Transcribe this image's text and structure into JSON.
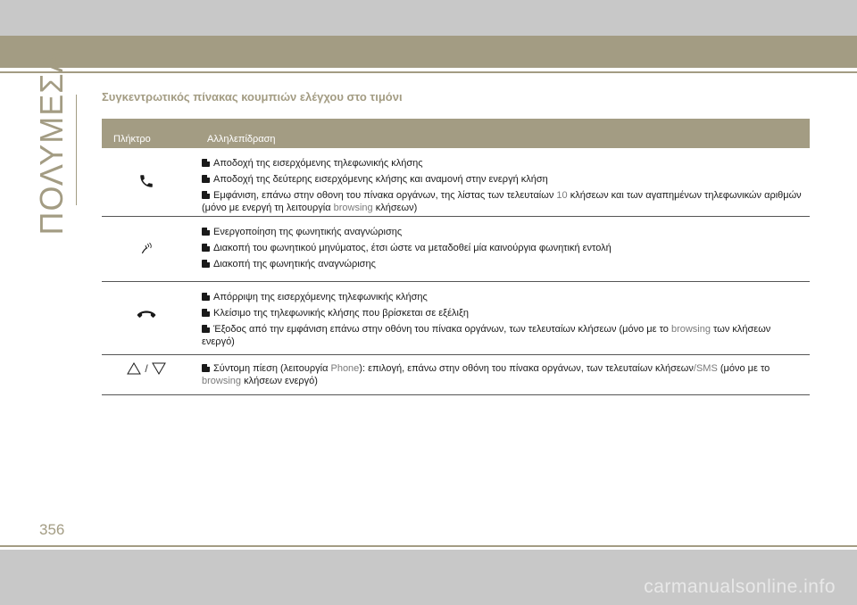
{
  "side_title": "ΠΟΛΥΜΕΣΑ",
  "section_title": "Συγκεντρωτικός πίνακας κουμπιών ελέγχου στο τιμόνι",
  "table": {
    "headers": {
      "key": "Πλήκτρο",
      "action": "Αλληλεπίδραση"
    },
    "rows": [
      {
        "icon": "phone-answer-icon",
        "items": [
          {
            "text": "Αποδοχή της εισερχόμενης τηλεφωνικής κλήσης"
          },
          {
            "text": "Αποδοχή της δεύτερης εισερχόμενης κλήσης και αναμονή στην ενεργή κλήση"
          },
          {
            "p1": "Εμφάνιση, επάνω στην οθονη του πίνακα οργάνων, της λίστας των τελευταίων ",
            "g1": "10",
            "p2": " κλήσεων και των αγαπημένων τηλεφωνικών αριθμών (μόνο με ενεργή τη λειτουργία ",
            "g2": "browsing",
            "p3": " κλήσεων)"
          }
        ]
      },
      {
        "icon": "voice-recognition-icon",
        "items": [
          {
            "text": "Ενεργοποίηση της φωνητικής αναγνώρισης"
          },
          {
            "text": "Διακοπή του φωνητικού μηνύματος, έτσι ώστε να μεταδοθεί μία καινούργια φωνητική εντολή"
          },
          {
            "text": "Διακοπή της φωνητικής αναγνώρισης"
          }
        ]
      },
      {
        "icon": "phone-hangup-icon",
        "items": [
          {
            "text": "Απόρριψη της εισερχόμενης τηλεφωνικής κλήσης"
          },
          {
            "text": "Κλείσιμο της τηλεφωνικής κλήσης που βρίσκεται σε εξέλιξη"
          },
          {
            "p1": "Έξοδος από την εμφάνιση επάνω στην οθόνη του πίνακα οργάνων, των τελευταίων κλήσεων (μόνο με το ",
            "g1": "browsing",
            "p2": " των κλήσεων ενεργό)"
          }
        ]
      },
      {
        "icon": "arrow-up-down-icons",
        "separator": "/",
        "items": [
          {
            "p1": "Σύντομη πίεση (λειτουργία ",
            "g1": "Phone",
            "p2": "): επιλογή, επάνω στην οθόνη του πίνακα οργάνων, των τελευταίων κλήσεων",
            "g2": "/SMS",
            "p3": " (μόνο με το ",
            "g3": "browsing",
            "p4": " κλήσεων ενεργό)"
          }
        ]
      }
    ]
  },
  "page_number": "356",
  "watermark": "carmanualsonline.info"
}
